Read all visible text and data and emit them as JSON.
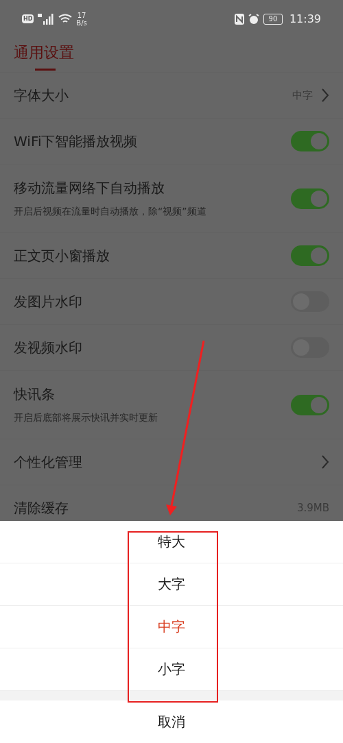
{
  "status_bar": {
    "hd_badge": "HD",
    "speed_value": "17",
    "speed_unit": "B/s",
    "battery": "90",
    "time": "11:39"
  },
  "title": "通用设置",
  "rows": [
    {
      "kind": "value",
      "label": "字体大小",
      "value": "中字",
      "chevron": true
    },
    {
      "kind": "toggle",
      "label": "WiFi下智能播放视频",
      "on": true
    },
    {
      "kind": "toggle",
      "label": "移动流量网络下自动播放",
      "hint": "开启后视频在流量时自动播放，除“视频”频道",
      "on": true
    },
    {
      "kind": "toggle",
      "label": "正文页小窗播放",
      "on": true
    },
    {
      "kind": "toggle",
      "label": "发图片水印",
      "on": false
    },
    {
      "kind": "toggle",
      "label": "发视频水印",
      "on": false
    },
    {
      "kind": "toggle",
      "label": "快讯条",
      "hint": "开启后底部将展示快讯并实时更新",
      "on": true
    },
    {
      "kind": "value",
      "label": "个性化管理",
      "chevron": true
    },
    {
      "kind": "value",
      "label": "清除缓存",
      "value": "3.9MB"
    }
  ],
  "sheet": {
    "options": [
      {
        "label": "特大",
        "selected": false
      },
      {
        "label": "大字",
        "selected": false
      },
      {
        "label": "中字",
        "selected": true
      },
      {
        "label": "小字",
        "selected": false
      }
    ],
    "cancel": "取消"
  }
}
